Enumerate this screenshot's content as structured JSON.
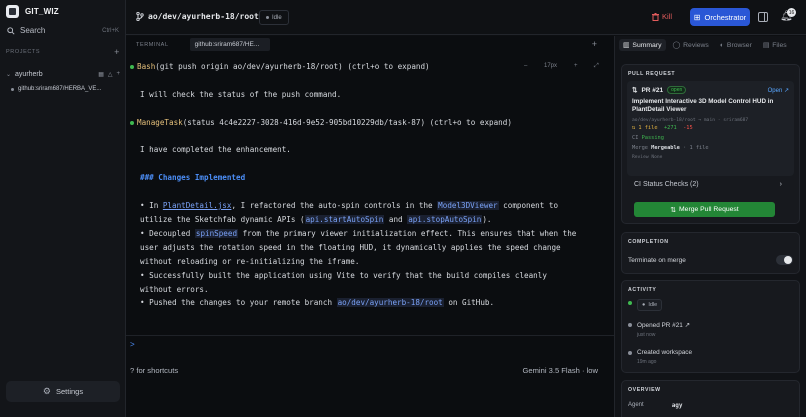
{
  "app": {
    "name": "GIT_WIZ"
  },
  "sidebar": {
    "search_label": "Search",
    "search_shortcut": "Ctrl+K",
    "projects_heading": "PROJECTS",
    "project": {
      "name": "ayurherb",
      "branch": "github:sriram687/HERBA_VE..."
    },
    "settings_label": "Settings"
  },
  "topbar": {
    "branch": "ao/dev/ayurherb-18/root",
    "status": "Idle",
    "kill_label": "Kill",
    "orchestrator_label": "Orchestrator",
    "notification_count": "16"
  },
  "terminal": {
    "section_label": "TERMINAL",
    "tab_label": "github:sriram687/HE...",
    "font_size": "17px",
    "lines": {
      "l1_tool": "Bash",
      "l1_rest": "(git push origin ao/dev/ayurherb-18/root) (ctrl+o to expand)",
      "l2": "I will check the status of the push command.",
      "l3_tool": "ManageTask",
      "l3_rest": "(status 4c4e2227-3028-416d-9e52-905bd10229db/task-87) (ctrl+o to expand)",
      "l4": "I have completed the enhancement.",
      "l5": "### Changes Implemented",
      "b1_a": "• In ",
      "b1_code1": "PlantDetail.jsx",
      "b1_b": ", I refactored the auto-spin controls in the ",
      "b1_code2": "Model3DViewer",
      "b1_c": " component to",
      "b1_d": "utilize the Sketchfab dynamic APIs (",
      "b1_code3": "api.startAutoSpin",
      "b1_e": " and ",
      "b1_code4": "api.stopAutoSpin",
      "b1_f": ").",
      "b2_a": "• Decoupled ",
      "b2_code": "spinSpeed",
      "b2_b": " from the primary viewer initialization effect. This ensures that when the",
      "b2_c": "user adjusts the rotation speed in the floating HUD, it dynamically applies the speed change",
      "b2_d": "without reloading or re-initializing the iframe.",
      "b3_a": "• Successfully built the application using Vite to verify that the build compiles cleanly",
      "b3_b": "without errors.",
      "b4_a": "• Pushed the changes to your remote branch ",
      "b4_code": "ao/dev/ayurherb-18/root",
      "b4_b": " on GitHub."
    },
    "prompt": ">",
    "footer_left": "? for shortcuts",
    "footer_right": "Gemini 3.5 Flash · low"
  },
  "right_panel": {
    "tabs": [
      "Summary",
      "Reviews",
      "Browser",
      "Files"
    ],
    "pull_request": {
      "heading": "PULL REQUEST",
      "number": "PR #21",
      "state": "open",
      "open_link": "Open",
      "title": "Implement Interactive 3D Model Control HUD in PlantDetail Viewer",
      "branch_line": "ao/dev/ayurherb-18/root → main · sriram687",
      "files": "1 file",
      "additions": "+271",
      "deletions": "-15",
      "ci_label": "CI",
      "ci_status": "Passing",
      "merge_label": "Merge",
      "merge_status": "Mergeable",
      "merge_files": "· 1 file",
      "review": "Review None",
      "ci_checks": "CI Status Checks (2)",
      "merge_button": "Merge Pull Request"
    },
    "completion": {
      "heading": "COMPLETION",
      "terminate_label": "Terminate on merge"
    },
    "activity": {
      "heading": "ACTIVITY",
      "idle": "Idle",
      "opened_pr": "Opened PR #21",
      "opened_time": "just now",
      "created": "Created workspace",
      "created_time": "19m ago"
    },
    "overview": {
      "heading": "OVERVIEW",
      "agent_label": "Agent",
      "agent_value": "agy"
    }
  },
  "colors": {
    "accent": "#2a57d6",
    "success": "#3fb950",
    "danger": "#e35c5c",
    "tool": "#e5c07b"
  }
}
